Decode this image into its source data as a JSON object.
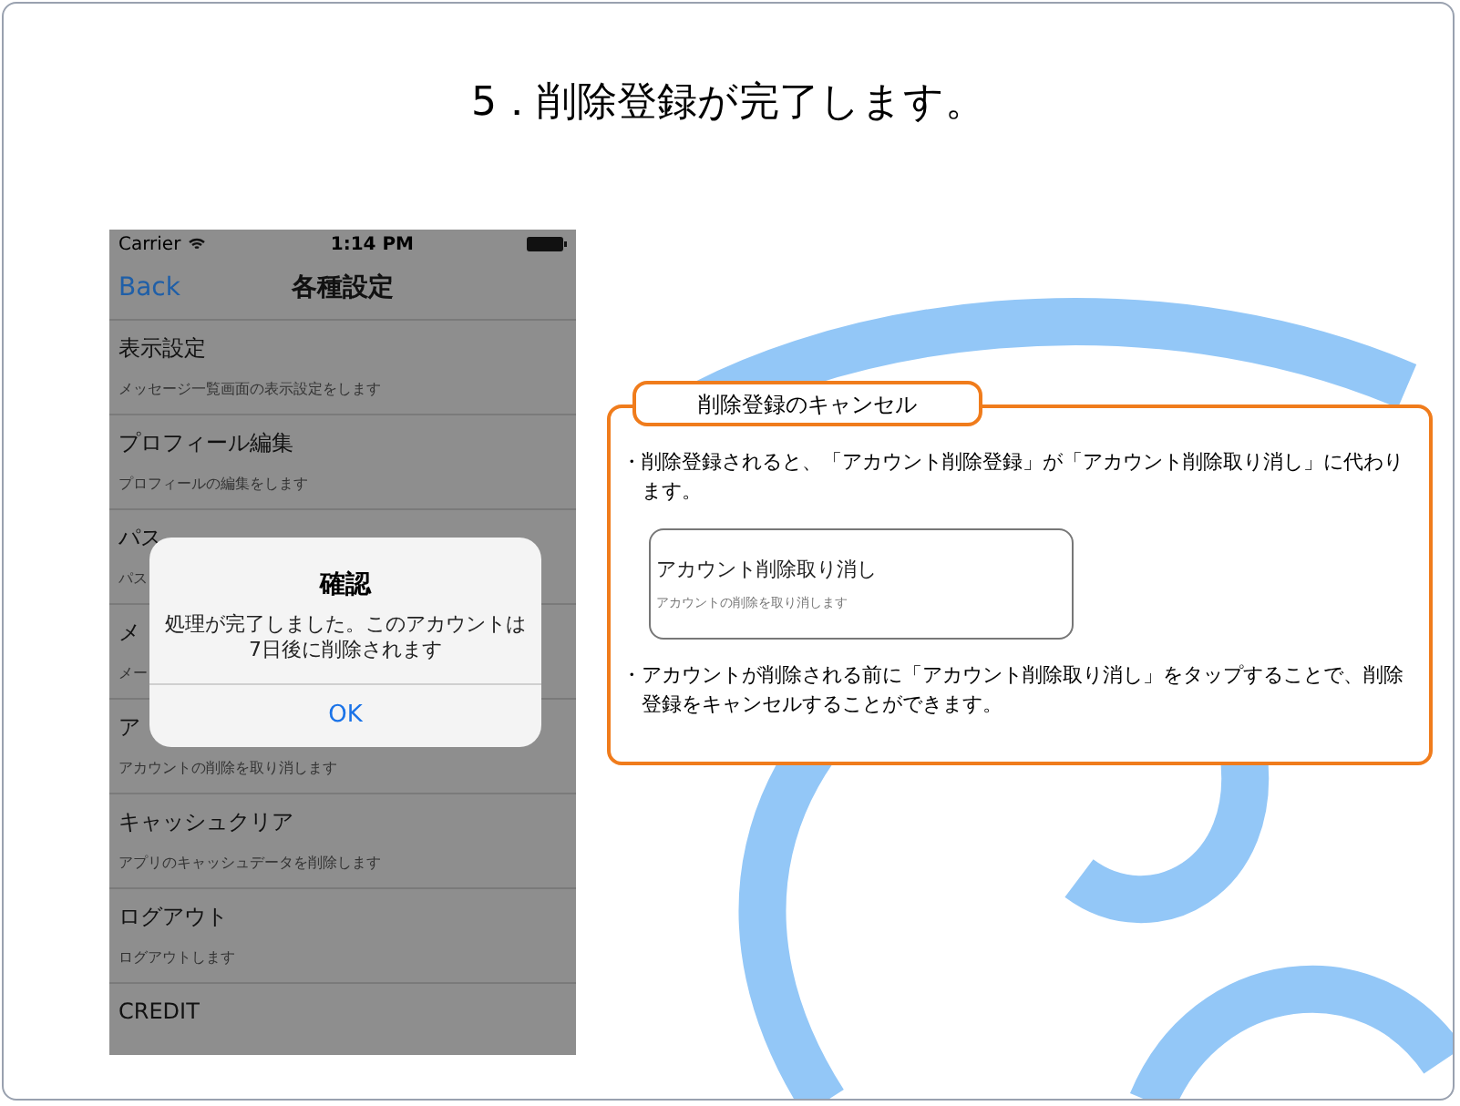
{
  "slide_title": "5．削除登録が完了します。",
  "phone": {
    "status_bar": {
      "carrier": "Carrier",
      "time": "1:14 PM"
    },
    "nav": {
      "back": "Back",
      "title": "各種設定"
    },
    "rows": [
      {
        "title": "表示設定",
        "subtitle": "メッセージ一覧画面の表示設定をします"
      },
      {
        "title": "プロフィール編集",
        "subtitle": "プロフィールの編集をします"
      },
      {
        "title": "パス",
        "subtitle": "パス"
      },
      {
        "title": "メ",
        "subtitle": "メー"
      },
      {
        "title": "ア",
        "subtitle": "アカウントの削除を取り消します"
      },
      {
        "title": "キャッシュクリア",
        "subtitle": "アプリのキャッシュデータを削除します"
      },
      {
        "title": "ログアウト",
        "subtitle": "ログアウトします"
      },
      {
        "title": "CREDIT"
      }
    ],
    "alert": {
      "title": "確認",
      "message": "処理が完了しました。このアカウントは\n7日後に削除されます",
      "button": "OK"
    }
  },
  "callout": {
    "label": "削除登録のキャンセル",
    "notes": [
      {
        "kind": "text",
        "text": "・削除登録されると、「アカウント削除登録」が「アカウント削除取り消し」に代わります。"
      },
      {
        "kind": "sample",
        "title": "アカウント削除取り消し",
        "subtitle": "アカウントの削除を取り消します"
      },
      {
        "kind": "text",
        "text": "・アカウントが削除される前に「アカウント削除取り消し」をタップすることで、削除登録をキャンセルすることができます。"
      }
    ]
  }
}
